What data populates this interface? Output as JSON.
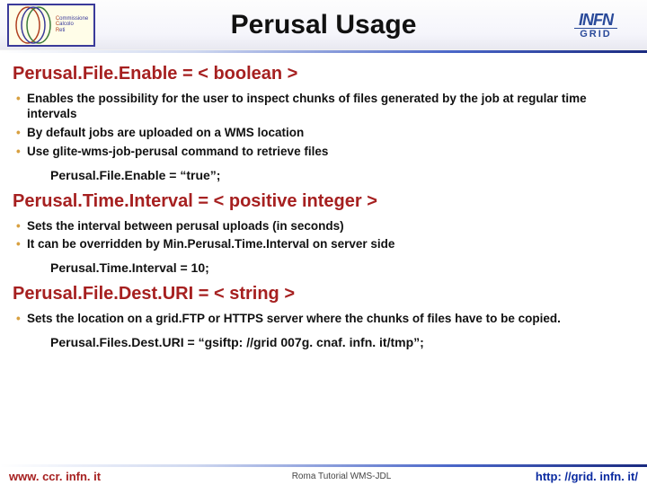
{
  "header": {
    "title": "Perusal Usage",
    "logo_left_lines": "C\nC\nR",
    "logo_right_top": "INFN",
    "logo_right_bottom": "GRID"
  },
  "sections": {
    "s1": {
      "heading": "Perusal.File.Enable = < boolean >",
      "bullets": [
        "Enables the possibility for the user to inspect chunks of files generated by the job at regular time intervals",
        "By default jobs are uploaded on a WMS location",
        "Use glite-wms-job-perusal command to retrieve files"
      ],
      "example": "Perusal.File.Enable = “true”;"
    },
    "s2": {
      "heading": "Perusal.Time.Interval = < positive integer >",
      "bullets": [
        "Sets the interval between perusal uploads  (in seconds)",
        "It can be overridden by Min.Perusal.Time.Interval on server side"
      ],
      "example": "Perusal.Time.Interval = 10;"
    },
    "s3": {
      "heading": "Perusal.File.Dest.URI = < string >",
      "bullets": [
        "Sets the location on a grid.FTP or HTTPS server where the chunks of files have to be copied."
      ],
      "example": "Perusal.Files.Dest.URI = “gsiftp: //grid 007g. cnaf. infn. it/tmp”;"
    }
  },
  "footer": {
    "left": "www. ccr. infn. it",
    "center": "Roma Tutorial   WMS-JDL",
    "right": "http: //grid. infn. it/"
  }
}
